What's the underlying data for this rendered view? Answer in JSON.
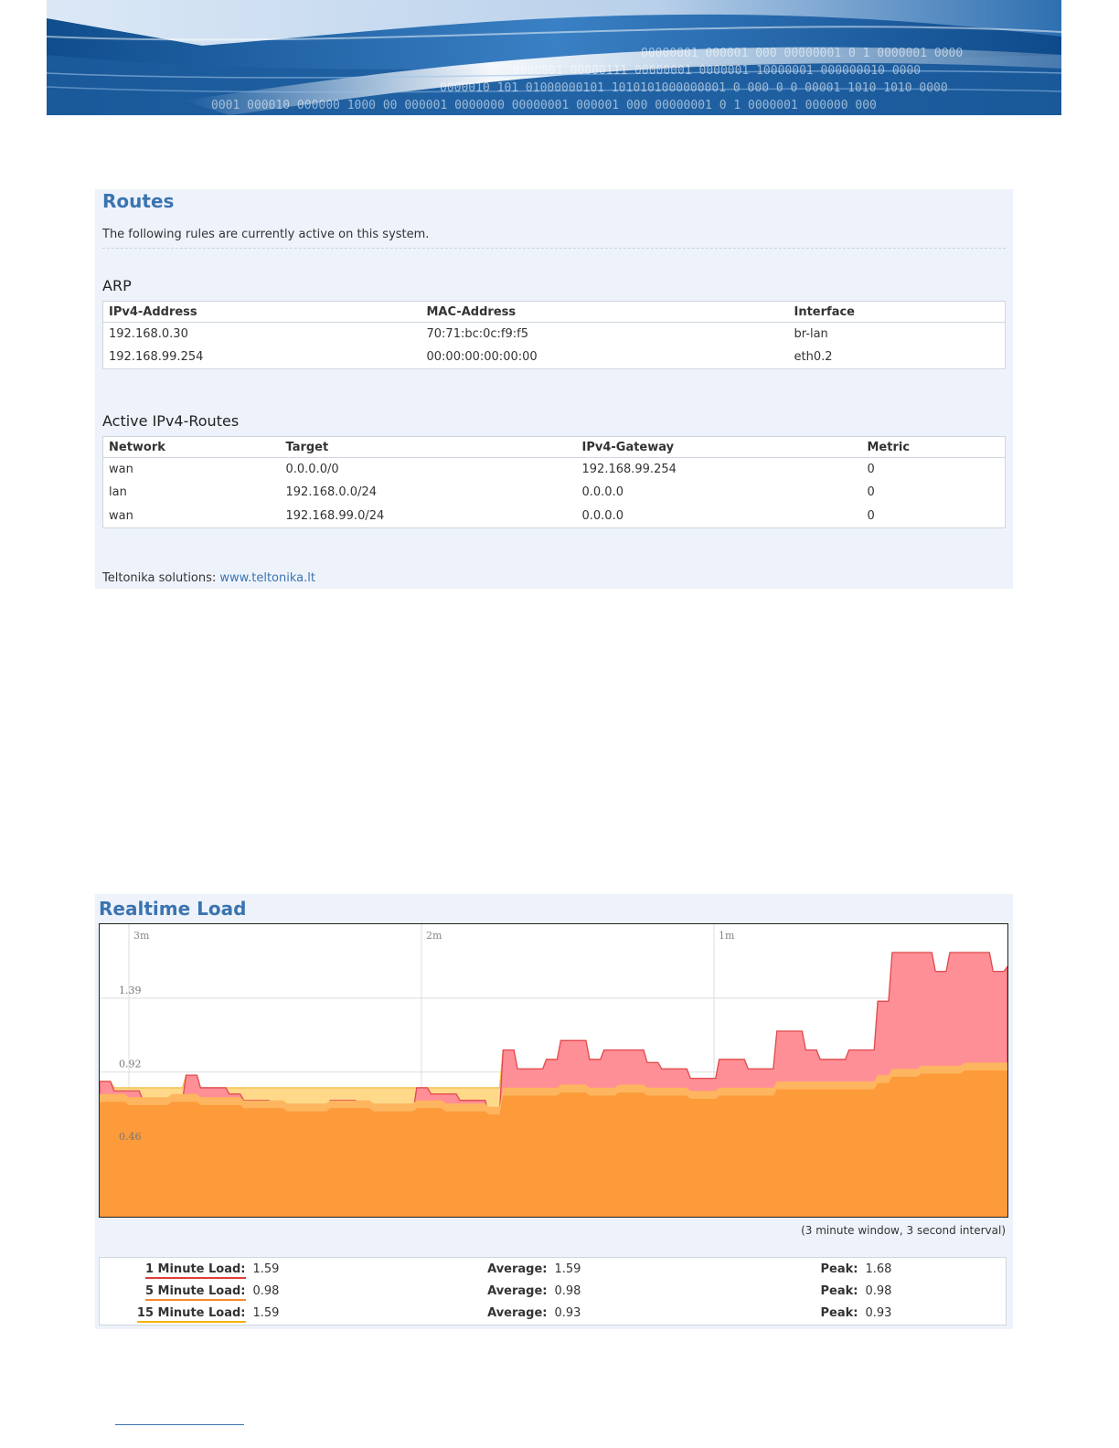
{
  "routes": {
    "title": "Routes",
    "description": "The following rules are currently active on this system.",
    "arp": {
      "title": "ARP",
      "columns": [
        "IPv4-Address",
        "MAC-Address",
        "Interface"
      ],
      "rows": [
        [
          "192.168.0.30",
          "70:71:bc:0c:f9:f5",
          "br-lan"
        ],
        [
          "192.168.99.254",
          "00:00:00:00:00:00",
          "eth0.2"
        ]
      ]
    },
    "ipv4": {
      "title": "Active IPv4-Routes",
      "columns": [
        "Network",
        "Target",
        "IPv4-Gateway",
        "Metric"
      ],
      "rows": [
        [
          "wan",
          "0.0.0.0/0",
          "192.168.99.254",
          "0"
        ],
        [
          "lan",
          "192.168.0.0/24",
          "0.0.0.0",
          "0"
        ],
        [
          "wan",
          "192.168.99.0/24",
          "0.0.0.0",
          "0"
        ]
      ]
    },
    "footer": {
      "prefix": "Teltonika solutions: ",
      "link_text": "www.teltonika.lt"
    }
  },
  "realtime_load": {
    "title": "Realtime Load",
    "window_note": "(3 minute window, 3 second interval)",
    "legend": [
      {
        "label": "1 Minute Load:",
        "value": "1.59",
        "avg_label": "Average:",
        "avg": "1.59",
        "peak_label": "Peak:",
        "peak": "1.68",
        "color": "#e23b3b"
      },
      {
        "label": "5 Minute Load:",
        "value": "0.98",
        "avg_label": "Average:",
        "avg": "0.98",
        "peak_label": "Peak:",
        "peak": "0.98",
        "color": "#f7892a"
      },
      {
        "label": "15 Minute Load:",
        "value": "1.59",
        "avg_label": "Average:",
        "avg": "0.93",
        "peak_label": "Peak:",
        "peak": "0.93",
        "color": "#f4b400"
      }
    ]
  },
  "chart_data": {
    "type": "area",
    "x_tick_labels": [
      "3m",
      "2m",
      "1m"
    ],
    "y_tick_labels": [
      "1.39",
      "0.92",
      "0.46"
    ],
    "ylim": [
      0,
      1.86
    ],
    "grid": true,
    "colors": {
      "load_1": "#ff8f96",
      "load_5": "#fdb55f",
      "load_15": "#ffd98a",
      "fill_base": "#fd9a3a"
    },
    "series": [
      {
        "name": "1 Minute Load",
        "values": [
          0.86,
          0.8,
          0.8,
          0.74,
          0.74,
          0.74,
          0.9,
          0.82,
          0.82,
          0.78,
          0.74,
          0.74,
          0.7,
          0.7,
          0.62,
          0.62,
          0.74,
          0.74,
          0.7,
          0.7,
          0.66,
          0.66,
          0.82,
          0.78,
          0.78,
          0.74,
          0.74,
          0.66,
          1.06,
          0.94,
          0.94,
          1.0,
          1.12,
          1.12,
          1.0,
          1.06,
          1.06,
          1.06,
          0.98,
          0.94,
          0.94,
          0.88,
          0.88,
          1.0,
          1.0,
          0.94,
          0.94,
          1.18,
          1.18,
          1.06,
          1.0,
          1.0,
          1.06,
          1.06,
          1.37,
          1.68,
          1.68,
          1.68,
          1.56,
          1.68,
          1.68,
          1.68,
          1.56,
          1.59
        ]
      },
      {
        "name": "5 Minute Load",
        "values": [
          0.78,
          0.78,
          0.76,
          0.76,
          0.76,
          0.78,
          0.78,
          0.76,
          0.76,
          0.76,
          0.74,
          0.74,
          0.74,
          0.72,
          0.72,
          0.72,
          0.74,
          0.74,
          0.74,
          0.72,
          0.72,
          0.72,
          0.74,
          0.74,
          0.72,
          0.72,
          0.72,
          0.7,
          0.82,
          0.82,
          0.82,
          0.82,
          0.84,
          0.84,
          0.82,
          0.82,
          0.84,
          0.84,
          0.82,
          0.82,
          0.82,
          0.8,
          0.8,
          0.82,
          0.82,
          0.82,
          0.82,
          0.86,
          0.86,
          0.86,
          0.86,
          0.86,
          0.86,
          0.86,
          0.9,
          0.94,
          0.94,
          0.96,
          0.96,
          0.96,
          0.98,
          0.98,
          0.98,
          0.98
        ]
      },
      {
        "name": "15 Minute Load",
        "values": [
          0.82,
          0.82,
          0.82,
          0.82,
          0.82,
          0.82,
          0.82,
          0.82,
          0.82,
          0.82,
          0.82,
          0.82,
          0.82,
          0.82,
          0.82,
          0.82,
          0.82,
          0.82,
          0.82,
          0.82,
          0.82,
          0.82,
          0.82,
          0.82,
          0.82,
          0.82,
          0.82,
          0.82,
          0.86,
          0.86,
          0.86,
          0.86,
          0.86,
          0.86,
          0.86,
          0.86,
          0.86,
          0.86,
          0.86,
          0.86,
          0.86,
          0.86,
          0.86,
          0.87,
          0.87,
          0.87,
          0.87,
          0.88,
          0.88,
          0.88,
          0.88,
          0.88,
          0.88,
          0.88,
          0.89,
          0.9,
          0.9,
          0.91,
          0.91,
          0.92,
          0.92,
          0.92,
          0.93,
          0.93
        ]
      }
    ]
  }
}
